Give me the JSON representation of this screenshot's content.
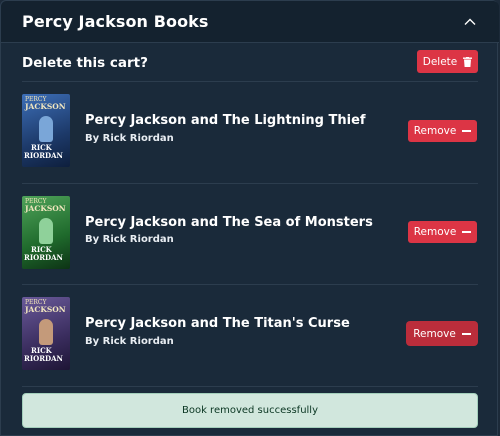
{
  "panel": {
    "title": "Percy Jackson Books",
    "collapse_icon": "chevron-up-icon"
  },
  "cart": {
    "label": "Delete this cart?",
    "delete_label": "Delete",
    "delete_icon": "trash-icon"
  },
  "books": [
    {
      "title": "Percy Jackson and The Lightning Thief",
      "author": "By Rick Riordan",
      "remove_label": "Remove",
      "remove_icon": "minus-icon",
      "cover": {
        "top": "PERCY",
        "series": "JACKSON",
        "rick": "RICK",
        "riordan": "RIORDAN",
        "color": "#2f5a99"
      }
    },
    {
      "title": "Percy Jackson and The Sea of Monsters",
      "author": "By Rick Riordan",
      "remove_label": "Remove",
      "remove_icon": "minus-icon",
      "cover": {
        "top": "PERCY",
        "series": "JACKSON",
        "rick": "RICK",
        "riordan": "RIORDAN",
        "color": "#2e7a3a"
      }
    },
    {
      "title": "Percy Jackson and The Titan's Curse",
      "author": "By Rick Riordan",
      "remove_label": "Remove",
      "remove_icon": "minus-icon",
      "cover": {
        "top": "PERCY",
        "series": "JACKSON",
        "rick": "RICK",
        "riordan": "RIORDAN",
        "color": "#4a3a6e"
      }
    }
  ],
  "toast": {
    "message": "Book removed successfully"
  },
  "colors": {
    "background": "#1a2a3a",
    "danger": "#dc3545",
    "success_bg": "#d1e7dd",
    "success_text": "#0a3622"
  }
}
